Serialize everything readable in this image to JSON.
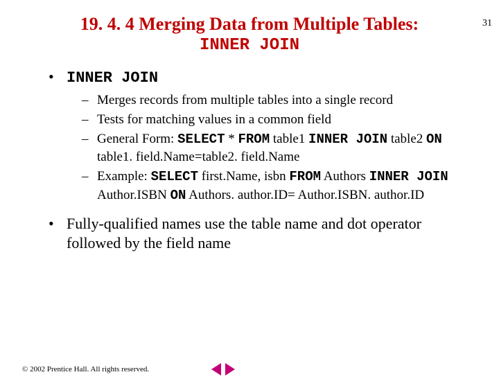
{
  "page_number": "31",
  "title": {
    "main": "19. 4. 4 Merging Data from Multiple Tables:",
    "sub": "INNER JOIN"
  },
  "bullets": {
    "b1_label": "INNER JOIN",
    "b1_sub": {
      "s1": "Merges records from multiple tables into a single record",
      "s2": "Tests for matching values in a common field",
      "s3_prefix": "General Form: ",
      "s3_kw1": "SELECT",
      "s3_mid1": " * ",
      "s3_kw2": "FROM",
      "s3_mid2": " table1 ",
      "s3_kw3": "INNER JOIN",
      "s3_mid3": " table2 ",
      "s3_kw4": "ON",
      "s3_tail": " table1. field.Name=table2. field.Name",
      "s4_prefix": "Example: ",
      "s4_kw1": "SELECT",
      "s4_mid1": " first.Name, isbn ",
      "s4_kw2": "FROM",
      "s4_mid2": " Authors ",
      "s4_kw3": "INNER JOIN",
      "s4_mid3": " Author.ISBN ",
      "s4_kw4": "ON",
      "s4_tail": " Authors. author.ID= Author.ISBN. author.ID"
    },
    "b2": "Fully-qualified names use the table name and dot operator followed by the field name"
  },
  "footer": {
    "copyright": "© 2002 Prentice Hall. All rights reserved."
  }
}
